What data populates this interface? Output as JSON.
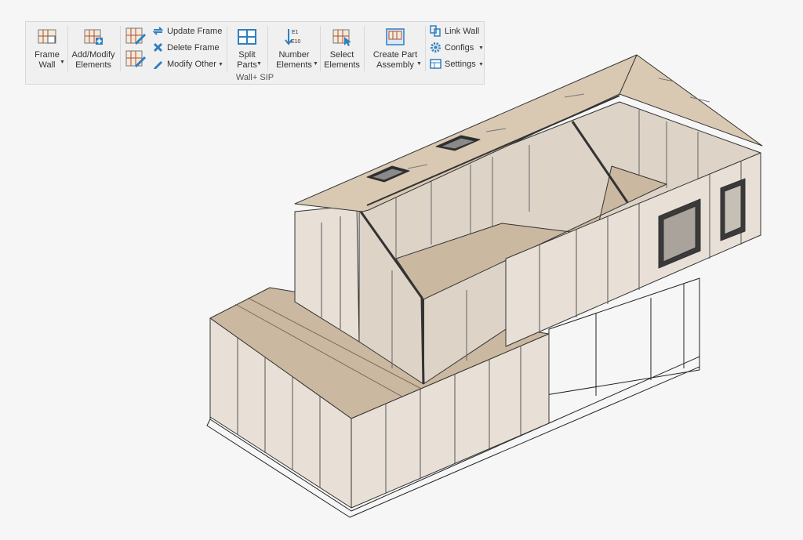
{
  "ribbon": {
    "frame_wall": [
      "Frame",
      "Wall"
    ],
    "add_modify": [
      "Add/Modify",
      "Elements"
    ],
    "update_frame": "Update Frame",
    "delete_frame": "Delete Frame",
    "modify_other": "Modify Other",
    "split_parts": [
      "Split",
      "Parts"
    ],
    "number_elements": [
      "Number",
      "Elements"
    ],
    "number_icon_top": "E1",
    "number_icon_bottom": "E10",
    "select_elements": [
      "Select",
      "Elements"
    ],
    "create_part_assembly": [
      "Create Part",
      "Assembly"
    ],
    "link_wall": "Link Wall",
    "configs": "Configs",
    "settings": "Settings",
    "group_label": "Wall+ SIP"
  },
  "colors": {
    "panel": "#e8e0d6",
    "roof": "#d9c9b3",
    "floor": "#cbb8a0",
    "accent_blue": "#2f7fc1"
  }
}
